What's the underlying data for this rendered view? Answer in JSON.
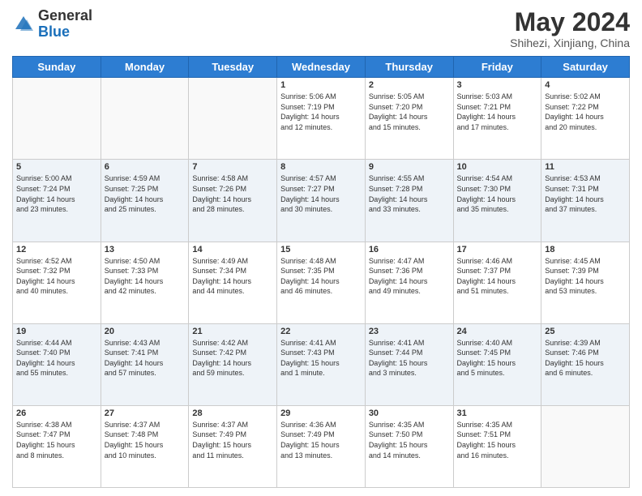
{
  "header": {
    "logo": {
      "general": "General",
      "blue": "Blue"
    },
    "title": "May 2024",
    "location": "Shihezi, Xinjiang, China"
  },
  "weekdays": [
    "Sunday",
    "Monday",
    "Tuesday",
    "Wednesday",
    "Thursday",
    "Friday",
    "Saturday"
  ],
  "weeks": [
    [
      {
        "day": "",
        "content": ""
      },
      {
        "day": "",
        "content": ""
      },
      {
        "day": "",
        "content": ""
      },
      {
        "day": "1",
        "content": "Sunrise: 5:06 AM\nSunset: 7:19 PM\nDaylight: 14 hours\nand 12 minutes."
      },
      {
        "day": "2",
        "content": "Sunrise: 5:05 AM\nSunset: 7:20 PM\nDaylight: 14 hours\nand 15 minutes."
      },
      {
        "day": "3",
        "content": "Sunrise: 5:03 AM\nSunset: 7:21 PM\nDaylight: 14 hours\nand 17 minutes."
      },
      {
        "day": "4",
        "content": "Sunrise: 5:02 AM\nSunset: 7:22 PM\nDaylight: 14 hours\nand 20 minutes."
      }
    ],
    [
      {
        "day": "5",
        "content": "Sunrise: 5:00 AM\nSunset: 7:24 PM\nDaylight: 14 hours\nand 23 minutes."
      },
      {
        "day": "6",
        "content": "Sunrise: 4:59 AM\nSunset: 7:25 PM\nDaylight: 14 hours\nand 25 minutes."
      },
      {
        "day": "7",
        "content": "Sunrise: 4:58 AM\nSunset: 7:26 PM\nDaylight: 14 hours\nand 28 minutes."
      },
      {
        "day": "8",
        "content": "Sunrise: 4:57 AM\nSunset: 7:27 PM\nDaylight: 14 hours\nand 30 minutes."
      },
      {
        "day": "9",
        "content": "Sunrise: 4:55 AM\nSunset: 7:28 PM\nDaylight: 14 hours\nand 33 minutes."
      },
      {
        "day": "10",
        "content": "Sunrise: 4:54 AM\nSunset: 7:30 PM\nDaylight: 14 hours\nand 35 minutes."
      },
      {
        "day": "11",
        "content": "Sunrise: 4:53 AM\nSunset: 7:31 PM\nDaylight: 14 hours\nand 37 minutes."
      }
    ],
    [
      {
        "day": "12",
        "content": "Sunrise: 4:52 AM\nSunset: 7:32 PM\nDaylight: 14 hours\nand 40 minutes."
      },
      {
        "day": "13",
        "content": "Sunrise: 4:50 AM\nSunset: 7:33 PM\nDaylight: 14 hours\nand 42 minutes."
      },
      {
        "day": "14",
        "content": "Sunrise: 4:49 AM\nSunset: 7:34 PM\nDaylight: 14 hours\nand 44 minutes."
      },
      {
        "day": "15",
        "content": "Sunrise: 4:48 AM\nSunset: 7:35 PM\nDaylight: 14 hours\nand 46 minutes."
      },
      {
        "day": "16",
        "content": "Sunrise: 4:47 AM\nSunset: 7:36 PM\nDaylight: 14 hours\nand 49 minutes."
      },
      {
        "day": "17",
        "content": "Sunrise: 4:46 AM\nSunset: 7:37 PM\nDaylight: 14 hours\nand 51 minutes."
      },
      {
        "day": "18",
        "content": "Sunrise: 4:45 AM\nSunset: 7:39 PM\nDaylight: 14 hours\nand 53 minutes."
      }
    ],
    [
      {
        "day": "19",
        "content": "Sunrise: 4:44 AM\nSunset: 7:40 PM\nDaylight: 14 hours\nand 55 minutes."
      },
      {
        "day": "20",
        "content": "Sunrise: 4:43 AM\nSunset: 7:41 PM\nDaylight: 14 hours\nand 57 minutes."
      },
      {
        "day": "21",
        "content": "Sunrise: 4:42 AM\nSunset: 7:42 PM\nDaylight: 14 hours\nand 59 minutes."
      },
      {
        "day": "22",
        "content": "Sunrise: 4:41 AM\nSunset: 7:43 PM\nDaylight: 15 hours\nand 1 minute."
      },
      {
        "day": "23",
        "content": "Sunrise: 4:41 AM\nSunset: 7:44 PM\nDaylight: 15 hours\nand 3 minutes."
      },
      {
        "day": "24",
        "content": "Sunrise: 4:40 AM\nSunset: 7:45 PM\nDaylight: 15 hours\nand 5 minutes."
      },
      {
        "day": "25",
        "content": "Sunrise: 4:39 AM\nSunset: 7:46 PM\nDaylight: 15 hours\nand 6 minutes."
      }
    ],
    [
      {
        "day": "26",
        "content": "Sunrise: 4:38 AM\nSunset: 7:47 PM\nDaylight: 15 hours\nand 8 minutes."
      },
      {
        "day": "27",
        "content": "Sunrise: 4:37 AM\nSunset: 7:48 PM\nDaylight: 15 hours\nand 10 minutes."
      },
      {
        "day": "28",
        "content": "Sunrise: 4:37 AM\nSunset: 7:49 PM\nDaylight: 15 hours\nand 11 minutes."
      },
      {
        "day": "29",
        "content": "Sunrise: 4:36 AM\nSunset: 7:49 PM\nDaylight: 15 hours\nand 13 minutes."
      },
      {
        "day": "30",
        "content": "Sunrise: 4:35 AM\nSunset: 7:50 PM\nDaylight: 15 hours\nand 14 minutes."
      },
      {
        "day": "31",
        "content": "Sunrise: 4:35 AM\nSunset: 7:51 PM\nDaylight: 15 hours\nand 16 minutes."
      },
      {
        "day": "",
        "content": ""
      }
    ]
  ]
}
